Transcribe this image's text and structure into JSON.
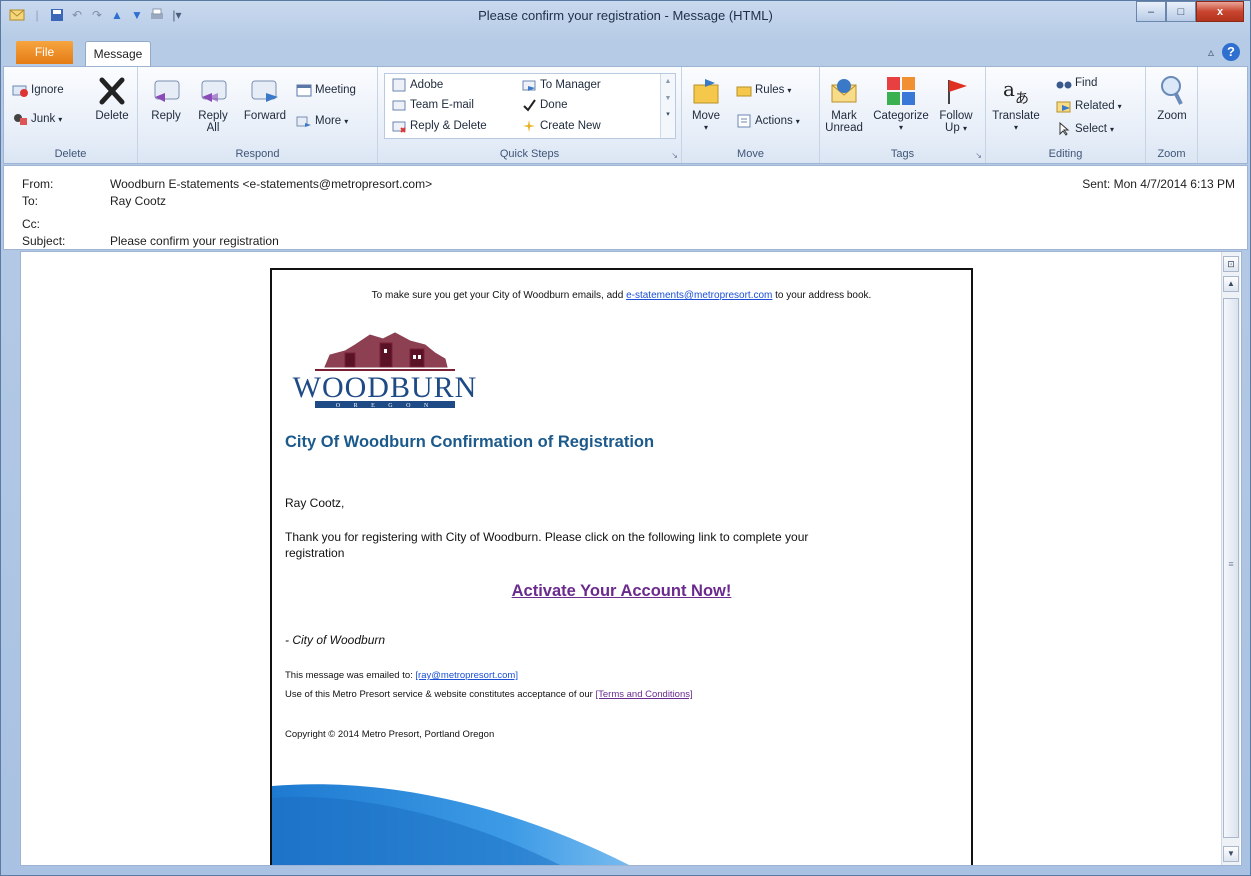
{
  "window": {
    "title": "Please confirm your registration  -  Message (HTML)",
    "minimize": "–",
    "maximize": "□",
    "close": "x"
  },
  "tabs": {
    "file": "File",
    "message": "Message"
  },
  "ribbon": {
    "delete_group": {
      "label": "Delete",
      "ignore": "Ignore",
      "junk": "Junk",
      "delete": "Delete"
    },
    "respond_group": {
      "label": "Respond",
      "reply": "Reply",
      "reply_all_1": "Reply",
      "reply_all_2": "All",
      "forward": "Forward",
      "meeting": "Meeting",
      "more": "More"
    },
    "quick_steps": {
      "label": "Quick Steps",
      "items": [
        "Adobe",
        "Team E-mail",
        "Reply & Delete",
        "To Manager",
        "Done",
        "Create New"
      ]
    },
    "move_group": {
      "label": "Move",
      "move": "Move",
      "rules": "Rules",
      "actions": "Actions"
    },
    "tags_group": {
      "label": "Tags",
      "mark_unread_1": "Mark",
      "mark_unread_2": "Unread",
      "categorize": "Categorize",
      "follow_up_1": "Follow",
      "follow_up_2": "Up"
    },
    "editing_group": {
      "label": "Editing",
      "translate": "Translate",
      "find": "Find",
      "related": "Related",
      "select": "Select"
    },
    "zoom_group": {
      "label": "Zoom",
      "zoom": "Zoom"
    }
  },
  "header": {
    "from_label": "From:",
    "from_value": "Woodburn E-statements <e-statements@metropresort.com>",
    "to_label": "To:",
    "to_value": "Ray Cootz",
    "cc_label": "Cc:",
    "subject_label": "Subject:",
    "subject_value": "Please confirm your registration",
    "sent": "Sent:   Mon 4/7/2014 6:13 PM"
  },
  "email": {
    "top_pre": "To make sure you get your City of Woodburn emails, add ",
    "top_link": "e-statements@metropresort.com",
    "top_post": " to your address book.",
    "logo_word": "WOODBURN",
    "logo_sub": "O R E G O N",
    "heading": "City Of Woodburn Confirmation of Registration",
    "greeting": "Ray Cootz,",
    "body_line1": "Thank you for registering with City of Woodburn. Please click on the following link to complete your",
    "body_line2": "registration",
    "cta": "Activate Your Account Now!",
    "signature": "- City of Woodburn",
    "emailed_to_pre": "This message was emailed to: ",
    "emailed_to_link": "[ray@metropresort.com]",
    "terms_pre": "Use of this Metro Presort service & website constitutes acceptance of our ",
    "terms_link": "[Terms and Conditions]",
    "copyright": "Copyright © 2014 Metro Presort, Portland Oregon"
  },
  "colors": {
    "file_tab": "#e57b13",
    "heading": "#1c5a8c",
    "cta": "#6a2a8e",
    "link": "#1a4fd6"
  }
}
